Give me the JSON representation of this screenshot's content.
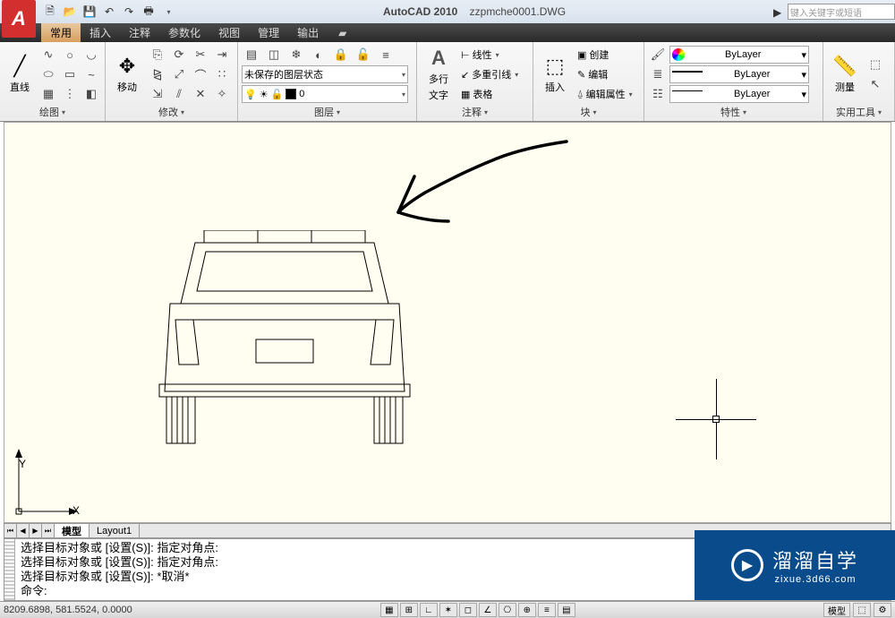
{
  "title": {
    "app": "AutoCAD 2010",
    "file": "zzpmche0001.DWG"
  },
  "search": {
    "placeholder": "键入关键字或短语"
  },
  "menu": {
    "tabs": [
      "常用",
      "插入",
      "注释",
      "参数化",
      "视图",
      "管理",
      "输出"
    ]
  },
  "ribbon": {
    "draw": {
      "label": "绘图",
      "line": "直线"
    },
    "modify": {
      "label": "修改",
      "move": "移动"
    },
    "layers": {
      "label": "图层",
      "state": "未保存的图层状态",
      "current": "0"
    },
    "annotate": {
      "label": "注释",
      "mtext_top": "多行",
      "mtext_bot": "文字",
      "linear": "线性",
      "mleader": "多重引线",
      "table": "表格"
    },
    "blocks": {
      "label": "块",
      "insert": "插入",
      "create": "创建",
      "edit": "编辑",
      "attr": "编辑属性"
    },
    "props": {
      "label": "特性",
      "bylayer": "ByLayer",
      "linewt": "ByLayer",
      "linetype": "ByLayer"
    },
    "util": {
      "label": "实用工具",
      "measure": "测量"
    }
  },
  "axes": {
    "x": "X",
    "y": "Y"
  },
  "layout": {
    "model": "模型",
    "layout1": "Layout1"
  },
  "command": {
    "l1": "选择目标对象或 [设置(S)]: 指定对角点:",
    "l2": "选择目标对象或 [设置(S)]: 指定对角点:",
    "l3": "选择目标对象或 [设置(S)]: *取消*",
    "prompt": "命令:"
  },
  "status": {
    "coords": "8209.6898, 581.5524, 0.0000",
    "space": "模型"
  },
  "watermark": {
    "brand": "溜溜自学",
    "url": "zixue.3d66.com"
  }
}
